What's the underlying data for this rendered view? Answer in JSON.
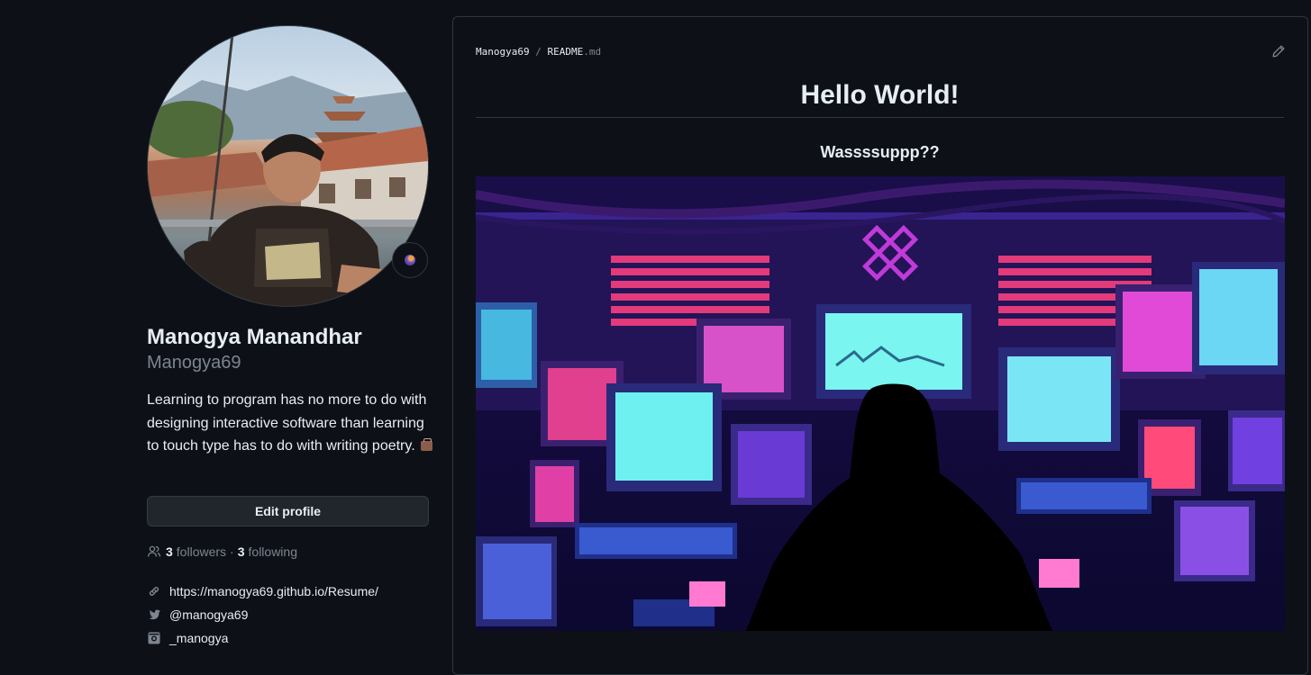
{
  "profile": {
    "full_name": "Manogya Manandhar",
    "username": "Manogya69",
    "bio": "Learning to program has no more to do with designing interactive software than learning to touch type has to do with writing poetry.",
    "bio_emoji": "briefcase-emoji",
    "edit_label": "Edit profile",
    "followers_count": "3",
    "followers_label": "followers",
    "following_count": "3",
    "following_label": "following",
    "separator": "·",
    "links": {
      "website": "https://manogya69.github.io/Resume/",
      "twitter": "@manogya69",
      "instagram": "_manogya"
    }
  },
  "readme": {
    "owner": "Manogya69",
    "crumb_sep": "/",
    "file_base": "README",
    "file_ext": ".md",
    "title": "Hello World!",
    "subtitle": "Wassssuppp??"
  },
  "colors": {
    "background": "#0d1117",
    "border": "#30363d",
    "text": "#e6edf3",
    "muted": "#7d8590",
    "button_bg": "#21262d"
  }
}
